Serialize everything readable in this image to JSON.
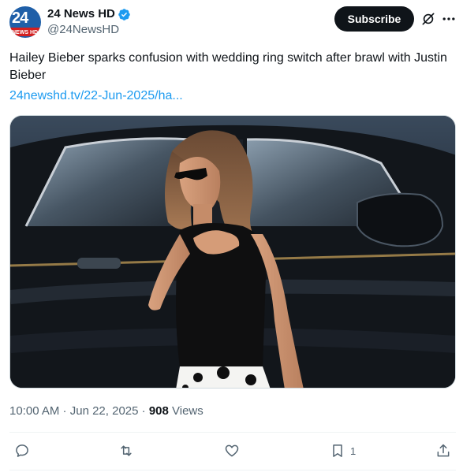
{
  "author": {
    "display_name": "24 News HD",
    "handle": "@24NewsHD",
    "avatar_text": "24",
    "avatar_subtext": "NEWS HD",
    "verified_color": "#1d9bf0"
  },
  "header": {
    "subscribe_label": "Subscribe",
    "grok_icon": "grok-icon",
    "more_icon": "more-icon"
  },
  "tweet": {
    "text": "Hailey Bieber sparks confusion with wedding ring switch after brawl with Justin Bieber",
    "link": "24newshd.tv/22-Jun-2025/ha...",
    "link_color": "#1d9bf0"
  },
  "media": {
    "image_icon": "photo-woman-by-black-car"
  },
  "meta": {
    "time": "10:00 AM",
    "separator1": " · ",
    "date": "Jun 22, 2025",
    "separator2": " · ",
    "views_count": "908",
    "views_label": " Views"
  },
  "actions": {
    "reply_icon": "reply-icon",
    "repost_icon": "repost-icon",
    "like_icon": "like-icon",
    "bookmark_icon": "bookmark-icon",
    "bookmark_count": "1",
    "share_icon": "share-icon"
  }
}
